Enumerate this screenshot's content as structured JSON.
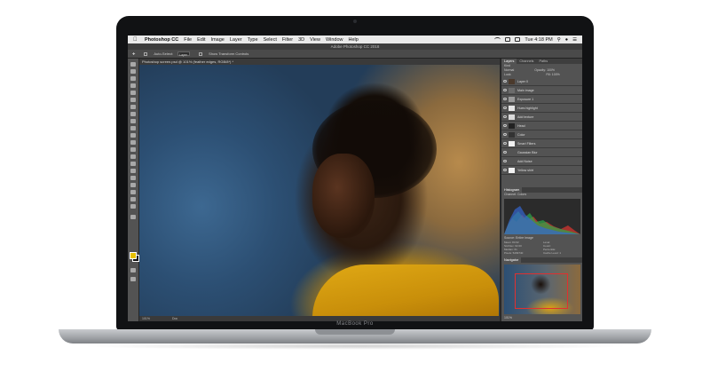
{
  "device": {
    "brand_label": "MacBook Pro"
  },
  "menubar": {
    "app_name": "Photoshop CC",
    "items": [
      "File",
      "Edit",
      "Image",
      "Layer",
      "Type",
      "Select",
      "Filter",
      "3D",
      "View",
      "Window",
      "Help"
    ],
    "clock": "Tue 4:18 PM"
  },
  "window": {
    "title": "Adobe Photoshop CC 2018"
  },
  "options_bar": {
    "auto_select_label": "Auto-Select:",
    "auto_select_value": "Layer",
    "transform_controls_label": "Show Transform Controls"
  },
  "document": {
    "tab_label": "Photoshop screen.psd @ 101% (feather edges, RGB/8*) *",
    "zoom": "101%",
    "status": "Doc"
  },
  "layers_panel": {
    "tabs": [
      "Layers",
      "Channels",
      "Paths"
    ],
    "kind_filter": "Kind",
    "blend_mode": "Normal",
    "opacity_label": "Opacity:",
    "opacity_value": "100%",
    "lock_label": "Lock:",
    "fill_label": "Fill:",
    "fill_value": "100%",
    "layers": [
      "Layer 0",
      "Main image",
      "Exposure 1",
      "Hues highlight",
      "Add texture",
      "Head",
      "Color",
      "Smart Filters",
      "Gaussian Blur",
      "Add Noise",
      "Yellow shirt"
    ]
  },
  "histogram_panel": {
    "title": "Histogram",
    "channel_label": "Channel:",
    "channel_value": "Colors",
    "source_label": "Source:",
    "source_value": "Entire Image",
    "stats": [
      "Mean: 83.62",
      "Std Dev: 62.00",
      "Median: 61",
      "Pixels: 5299740"
    ],
    "stats_right": [
      "Level:",
      "Count:",
      "Percentile:",
      "Cache Level: 1"
    ]
  },
  "navigator_panel": {
    "title": "Navigator",
    "zoom": "101%"
  }
}
